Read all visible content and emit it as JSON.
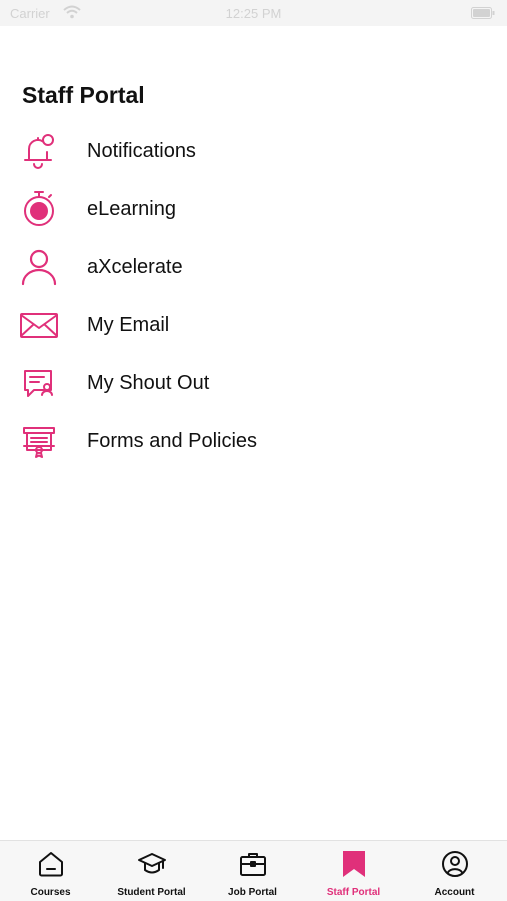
{
  "status_bar": {
    "carrier": "Carrier",
    "time": "12:25 PM"
  },
  "colors": {
    "accent": "#e0307a",
    "text": "#111111",
    "tab_bg": "#f7f7f7"
  },
  "page": {
    "title": "Staff Portal"
  },
  "menu": [
    {
      "label": "Notifications",
      "icon": "bell-icon"
    },
    {
      "label": "eLearning",
      "icon": "stopwatch-icon"
    },
    {
      "label": "aXcelerate",
      "icon": "user-icon"
    },
    {
      "label": "My Email",
      "icon": "mail-icon"
    },
    {
      "label": "My Shout Out",
      "icon": "chat-certificate-icon"
    },
    {
      "label": "Forms and Policies",
      "icon": "forms-icon"
    }
  ],
  "tabs": [
    {
      "label": "Courses",
      "icon": "home-icon",
      "active": false
    },
    {
      "label": "Student Portal",
      "icon": "graduation-cap-icon",
      "active": false
    },
    {
      "label": "Job Portal",
      "icon": "briefcase-icon",
      "active": false
    },
    {
      "label": "Staff Portal",
      "icon": "bookmark-icon",
      "active": true
    },
    {
      "label": "Account",
      "icon": "account-icon",
      "active": false
    }
  ]
}
